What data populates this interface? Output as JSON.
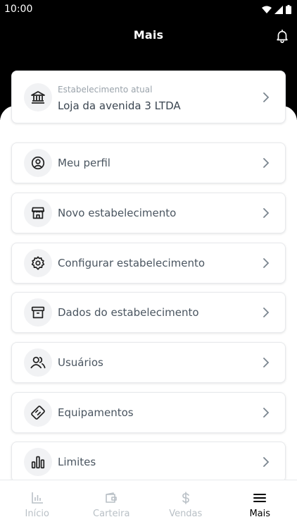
{
  "status": {
    "time": "10:00"
  },
  "header": {
    "title": "Mais"
  },
  "establishment": {
    "caption": "Estabelecimento atual",
    "name": "Loja da avenida 3 LTDA"
  },
  "menu": [
    {
      "label": "Meu perfil",
      "icon": "user-circle-icon"
    },
    {
      "label": "Novo estabelecimento",
      "icon": "store-icon"
    },
    {
      "label": "Configurar estabelecimento",
      "icon": "gear-icon"
    },
    {
      "label": "Dados do estabelecimento",
      "icon": "archive-icon"
    },
    {
      "label": "Usuários",
      "icon": "users-icon"
    },
    {
      "label": "Equipamentos",
      "icon": "card-reader-icon"
    },
    {
      "label": "Limites",
      "icon": "bar-chart-icon"
    }
  ],
  "tabs": [
    {
      "label": "Início",
      "icon": "chart-icon",
      "active": false
    },
    {
      "label": "Carteira",
      "icon": "wallet-icon",
      "active": false
    },
    {
      "label": "Vendas",
      "icon": "dollar-icon",
      "active": false
    },
    {
      "label": "Mais",
      "icon": "menu-icon",
      "active": true
    }
  ],
  "colors": {
    "header": "#000000",
    "text": "#4a5560",
    "muted": "#9aa3ab",
    "inactive_tab": "#b9c0c6"
  }
}
